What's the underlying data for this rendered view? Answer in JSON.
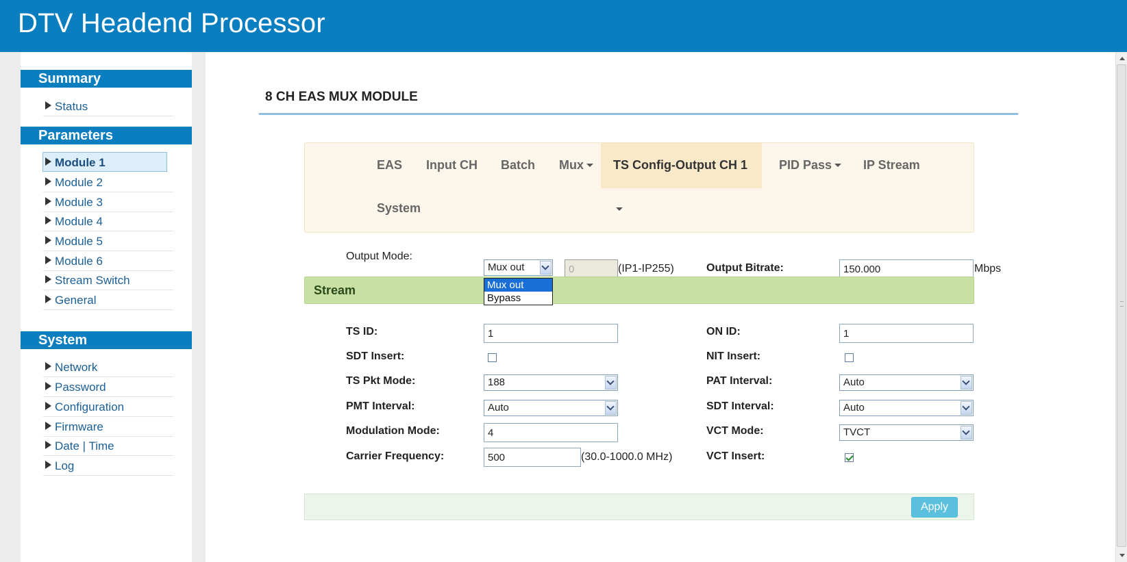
{
  "app": {
    "title": "DTV Headend Processor"
  },
  "sidebar": {
    "sections": [
      {
        "title": "Summary"
      },
      {
        "title": "Parameters"
      },
      {
        "title": "System"
      }
    ],
    "summary_items": [
      {
        "label": "Status"
      }
    ],
    "parameters_items": [
      {
        "label": "Module 1",
        "active": true
      },
      {
        "label": "Module 2"
      },
      {
        "label": "Module 3"
      },
      {
        "label": "Module 4"
      },
      {
        "label": "Module 5"
      },
      {
        "label": "Module 6"
      },
      {
        "label": "Stream Switch"
      },
      {
        "label": "General"
      }
    ],
    "system_items": [
      {
        "label": "Network"
      },
      {
        "label": "Password"
      },
      {
        "label": "Configuration"
      },
      {
        "label": "Firmware"
      },
      {
        "label": "Date | Time"
      },
      {
        "label": "Log"
      }
    ]
  },
  "main": {
    "page_title": "8 CH EAS MUX MODULE",
    "tabs": [
      {
        "label": "EAS"
      },
      {
        "label": "Input CH"
      },
      {
        "label": "Batch"
      },
      {
        "label": "Mux",
        "has_caret": true
      },
      {
        "label": "TS Config-Output CH 1",
        "has_caret": true,
        "active": true
      },
      {
        "label": "PID Pass",
        "has_caret": true
      },
      {
        "label": "IP Stream"
      },
      {
        "label": "System"
      }
    ]
  },
  "output": {
    "mode_label": "Output Mode:",
    "mode_value": "Mux out",
    "mode_options": [
      "Mux out",
      "Bypass"
    ],
    "ip_value": "0",
    "ip_hint": "(IP1-IP255)",
    "bitrate_label": "Output Bitrate:",
    "bitrate_value": "150.000",
    "bitrate_unit": "Mbps"
  },
  "stream": {
    "title": "Stream",
    "ts_id_label": "TS ID:",
    "ts_id_value": "1",
    "on_id_label": "ON ID:",
    "on_id_value": "1",
    "sdt_insert_label": "SDT Insert:",
    "sdt_insert_checked": false,
    "nit_insert_label": "NIT Insert:",
    "nit_insert_checked": false,
    "ts_pkt_mode_label": "TS Pkt Mode:",
    "ts_pkt_mode_value": "188",
    "pat_interval_label": "PAT Interval:",
    "pat_interval_value": "Auto",
    "pmt_interval_label": "PMT Interval:",
    "pmt_interval_value": "Auto",
    "sdt_interval_label": "SDT Interval:",
    "sdt_interval_value": "Auto",
    "modulation_mode_label": "Modulation Mode:",
    "modulation_mode_value": "4",
    "vct_mode_label": "VCT Mode:",
    "vct_mode_value": "TVCT",
    "carrier_freq_label": "Carrier Frequency:",
    "carrier_freq_value": "500",
    "carrier_freq_hint": "(30.0-1000.0 MHz)",
    "vct_insert_label": "VCT Insert:",
    "vct_insert_checked": true
  },
  "actions": {
    "apply_label": "Apply"
  },
  "colors": {
    "brand": "#0a7ebf",
    "tab_bar_bg": "#fdf7eb",
    "tab_active_bg": "#fae9c9",
    "stream_bar_bg": "#c8e0a3",
    "apply_btn": "#5bc0de"
  }
}
